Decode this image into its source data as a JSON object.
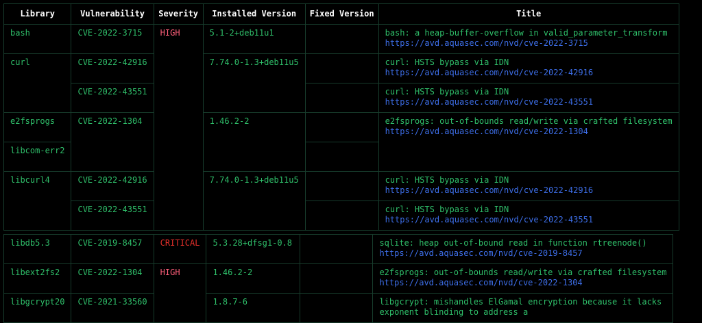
{
  "headers": [
    "Library",
    "Vulnerability",
    "Severity",
    "Installed Version",
    "Fixed Version",
    "Title"
  ],
  "colors": {
    "background": "#000000",
    "text": "#2fbf6a",
    "header": "#ffffff",
    "high": "#ff5f7a",
    "critical": "#e8302b",
    "link": "#3d6ee8",
    "border": "#173c2c"
  },
  "libraries": {
    "bash": "bash",
    "curl": "curl",
    "e2fsprogs": "e2fsprogs",
    "libcom_err2": "libcom-err2",
    "libcurl4": "libcurl4",
    "libdb5_3": "libdb5.3",
    "libext2fs2": "libext2fs2",
    "libgcrypt20": "libgcrypt20"
  },
  "vulns": {
    "r1": "CVE-2022-3715",
    "r2": "CVE-2022-42916",
    "r3": "CVE-2022-43551",
    "r4": "CVE-2022-1304",
    "r6": "CVE-2022-42916",
    "r7": "CVE-2022-43551",
    "r8": "CVE-2019-8457",
    "r9": "CVE-2022-1304",
    "r10": "CVE-2021-33560"
  },
  "severity": {
    "high1": "HIGH",
    "critical": "CRITICAL",
    "high2": "HIGH"
  },
  "installed": {
    "bash": "5.1-2+deb11u1",
    "curl": "7.74.0-1.3+deb11u5",
    "e2fsprogs": "1.46.2-2",
    "libcurl4": "7.74.0-1.3+deb11u5",
    "libdb": "5.3.28+dfsg1-0.8",
    "libext2fs2": "1.46.2-2",
    "libgcrypt20": "1.8.7-6"
  },
  "titles": {
    "r1": {
      "text": "bash: a heap-buffer-overflow in valid_parameter_transform",
      "link": "https://avd.aquasec.com/nvd/cve-2022-3715"
    },
    "r2": {
      "text": "curl: HSTS bypass via IDN",
      "link": "https://avd.aquasec.com/nvd/cve-2022-42916"
    },
    "r3": {
      "text": "curl: HSTS bypass via IDN",
      "link": "https://avd.aquasec.com/nvd/cve-2022-43551"
    },
    "r4": {
      "text": "e2fsprogs: out-of-bounds read/write via crafted filesystem",
      "link": "https://avd.aquasec.com/nvd/cve-2022-1304"
    },
    "r6": {
      "text": "curl: HSTS bypass via IDN",
      "link": "https://avd.aquasec.com/nvd/cve-2022-42916"
    },
    "r7": {
      "text": "curl: HSTS bypass via IDN",
      "link": "https://avd.aquasec.com/nvd/cve-2022-43551"
    },
    "r8": {
      "text": "sqlite: heap out-of-bound read in function rtreenode()",
      "link": "https://avd.aquasec.com/nvd/cve-2019-8457"
    },
    "r9": {
      "text": "e2fsprogs: out-of-bounds read/write via crafted filesystem",
      "link": "https://avd.aquasec.com/nvd/cve-2022-1304"
    },
    "r10": {
      "text": "libgcrypt: mishandles ElGamal encryption because it lacks",
      "text2": "exponent blinding to address a"
    }
  }
}
